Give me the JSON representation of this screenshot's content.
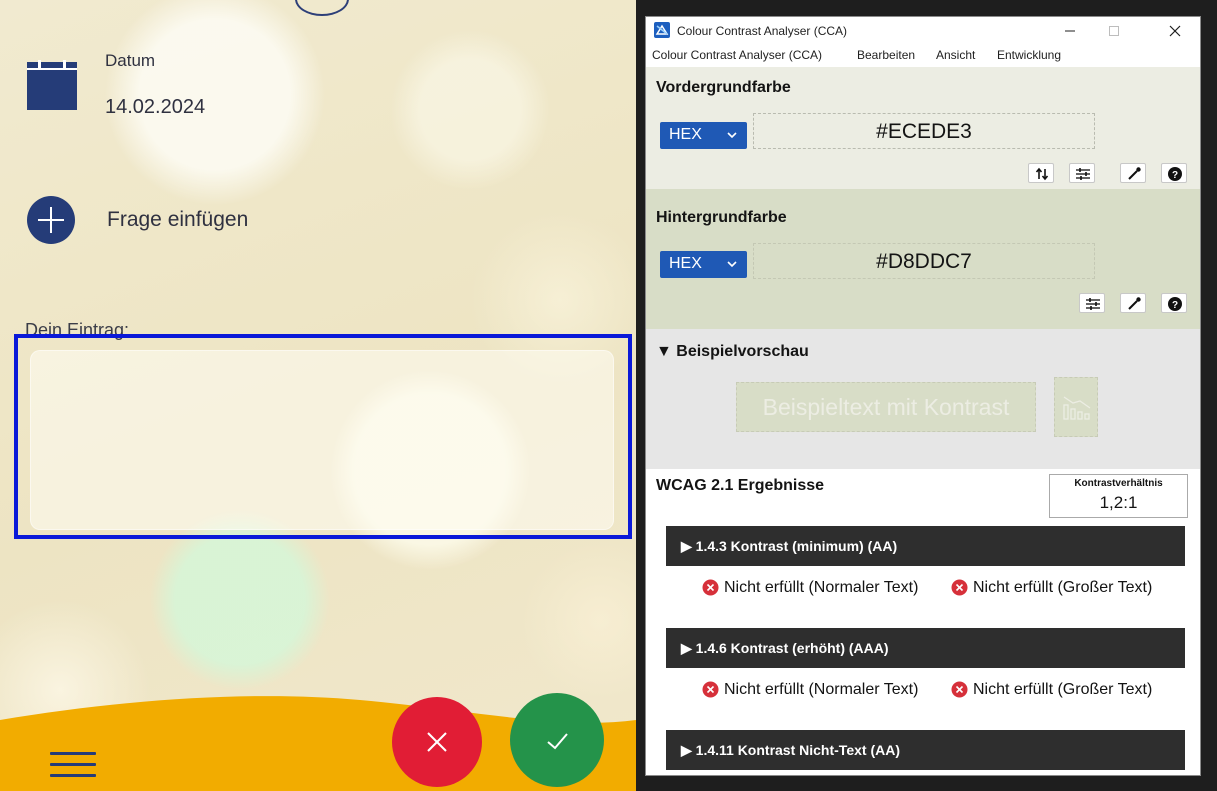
{
  "app": {
    "date_label": "Datum",
    "date_value": "14.02.2024",
    "add_question_label": "Frage einfügen",
    "entry_label": "Dein Eintrag:",
    "entry_value": ""
  },
  "cca": {
    "window_title": "Colour Contrast Analyser (CCA)",
    "menu": [
      "Colour Contrast Analyser (CCA)",
      "Bearbeiten",
      "Ansicht",
      "Entwicklung"
    ],
    "foreground": {
      "title": "Vordergrundfarbe",
      "format": "HEX",
      "value": "#ECEDE3"
    },
    "background": {
      "title": "Hintergrundfarbe",
      "format": "HEX",
      "value": "#D8DDC7"
    },
    "preview": {
      "title": "▼ Beispielvorschau",
      "sample_text": "Beispieltext mit Kontrast"
    },
    "results": {
      "title": "WCAG 2.1 Ergebnisse",
      "ratio_label": "Kontrastverhältnis",
      "ratio_value": "1,2:1",
      "criteria": [
        {
          "label": "▶ 1.4.3 Kontrast (minimum) (AA)",
          "normal": "Nicht erfüllt (Normaler Text)",
          "large": "Nicht erfüllt (Großer Text)"
        },
        {
          "label": "▶ 1.4.6 Kontrast (erhöht) (AAA)",
          "normal": "Nicht erfüllt (Normaler Text)",
          "large": "Nicht erfüllt (Großer Text)"
        },
        {
          "label": "▶ 1.4.11 Kontrast Nicht-Text (AA)"
        }
      ]
    }
  },
  "colors": {
    "primary_navy": "#253c78",
    "cancel_red": "#e11d35",
    "confirm_green": "#24934a",
    "highlight_blue": "#0a19d8",
    "bottom_yellow": "#f2ac00",
    "cca_select_blue": "#1f59b5"
  },
  "icons": [
    "calendar-icon",
    "plus-icon",
    "menu-icon",
    "close-icon",
    "check-icon",
    "swap-icon",
    "sliders-icon",
    "eyedropper-icon",
    "help-icon",
    "fail-icon",
    "chart-icon"
  ]
}
